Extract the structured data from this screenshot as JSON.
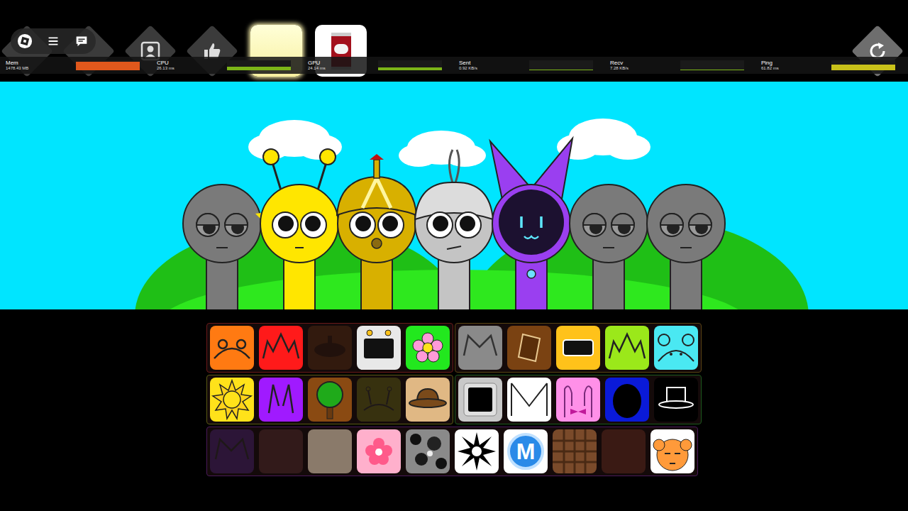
{
  "tools": [
    {
      "kind": "glow",
      "selected": true
    },
    {
      "kind": "can",
      "selected": false
    }
  ],
  "stats": [
    {
      "label": "Mem",
      "value": "1478.43 MB",
      "level": 0.85,
      "color": "#e0581c"
    },
    {
      "label": "CPU",
      "value": "26.13 ms",
      "level": 0.35,
      "color": "#7cb518"
    },
    {
      "label": "GPU",
      "value": "24.14 ms",
      "level": 0.3,
      "color": "#7cb518"
    },
    {
      "label": "Sent",
      "value": "0.92 KB/s",
      "level": 0.1,
      "color": "#7cb518"
    },
    {
      "label": "Recv",
      "value": "7.28 KB/s",
      "level": 0.05,
      "color": "#7cb518"
    },
    {
      "label": "Ping",
      "value": "61.82 ms",
      "level": 0.55,
      "color": "#c9c21a"
    }
  ],
  "characters": [
    {
      "kind": "sleepy",
      "color": "#7a7a7a"
    },
    {
      "kind": "antenna",
      "color": "#ffe600"
    },
    {
      "kind": "hat",
      "color": "#d8b000"
    },
    {
      "kind": "spike",
      "color": "#c4c4c4"
    },
    {
      "kind": "cat",
      "color": "#9a3ff0"
    },
    {
      "kind": "sleepy",
      "color": "#7a7a7a"
    },
    {
      "kind": "sleepy",
      "color": "#7a7a7a"
    }
  ],
  "palette": [
    {
      "groups": [
        {
          "color": "#6b1a1a",
          "icons": [
            {
              "kind": "ears",
              "color": "#ff7a12",
              "used": false
            },
            {
              "kind": "spikes",
              "color": "#ff1a1a",
              "used": false
            },
            {
              "kind": "pot",
              "color": "#6a3a18",
              "used": true
            },
            {
              "kind": "tv",
              "color": "#e8e8e8",
              "used": false
            },
            {
              "kind": "flower",
              "color": "#22e81e",
              "used": false
            }
          ]
        },
        {
          "color": "#5a4414",
          "icons": [
            {
              "kind": "catears",
              "color": "#8a8a8a",
              "used": false
            },
            {
              "kind": "bucket",
              "color": "#7a4212",
              "used": false
            },
            {
              "kind": "visor",
              "color": "#ffc21a",
              "used": false
            },
            {
              "kind": "spikes",
              "color": "#9be81a",
              "used": false
            },
            {
              "kind": "bearears",
              "color": "#4ae8f2",
              "used": false
            }
          ]
        }
      ]
    },
    {
      "groups": [
        {
          "color": "#5a5a14",
          "icons": [
            {
              "kind": "sun",
              "color": "#ffe21a",
              "used": false
            },
            {
              "kind": "horns",
              "color": "#a01aff",
              "used": false
            },
            {
              "kind": "tree",
              "color": "#8a4a12",
              "used": false
            },
            {
              "kind": "antennae",
              "color": "#7a7a1a",
              "used": true
            },
            {
              "kind": "hat",
              "color": "#e0b884",
              "used": false
            }
          ]
        },
        {
          "color": "#1e5a1e",
          "icons": [
            {
              "kind": "monitor",
              "color": "#c8c8c8",
              "used": false
            },
            {
              "kind": "envelope",
              "color": "#ffffff",
              "used": false
            },
            {
              "kind": "bow",
              "color": "#ff90e8",
              "used": false
            },
            {
              "kind": "hood",
              "color": "#0a1ad8",
              "used": false
            },
            {
              "kind": "tophat",
              "color": "#000000",
              "used": false
            }
          ]
        }
      ]
    },
    {
      "groups": [
        {
          "color": "#4a1a5a",
          "icons": [
            {
              "kind": "catears",
              "color": "#5a2a8a",
              "used": true
            },
            {
              "kind": "blank",
              "color": "#6a3a3a",
              "used": true
            },
            {
              "kind": "photo",
              "color": "#8a7a6a",
              "used": false
            },
            {
              "kind": "blossom",
              "color": "#ffb0cc",
              "used": false
            },
            {
              "kind": "noise",
              "color": "#8a8a8a",
              "used": false
            },
            {
              "kind": "star",
              "color": "#ffffff",
              "used": false
            },
            {
              "kind": "letter",
              "color": "#ffffff",
              "text": "M",
              "used": false
            },
            {
              "kind": "grid",
              "color": "#7a4a2a",
              "used": false
            },
            {
              "kind": "photo",
              "color": "#3a1a14",
              "used": false
            },
            {
              "kind": "face",
              "color": "#ffffff",
              "used": false
            }
          ]
        }
      ]
    }
  ]
}
